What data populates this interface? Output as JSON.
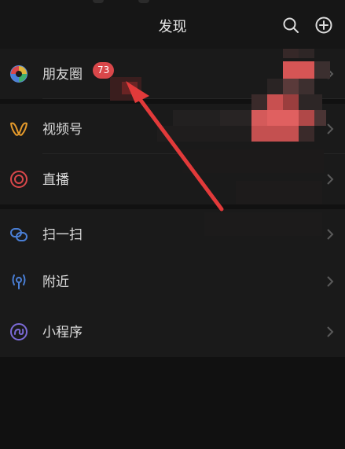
{
  "header": {
    "title": "发现",
    "search_icon": "search-icon",
    "add_icon": "plus-circle-icon"
  },
  "items": [
    {
      "label": "朋友圈",
      "icon": "moments-icon",
      "badge": "73"
    },
    {
      "label": "视频号",
      "icon": "channels-icon"
    },
    {
      "label": "直播",
      "icon": "live-icon"
    },
    {
      "label": "扫一扫",
      "icon": "scan-icon"
    },
    {
      "label": "附近",
      "icon": "nearby-icon"
    },
    {
      "label": "小程序",
      "icon": "mini-program-icon"
    }
  ],
  "colors": {
    "background": "#111111",
    "row": "#1a1a1a",
    "badge": "#d9474a",
    "annotation_arrow": "#e23a3a"
  }
}
